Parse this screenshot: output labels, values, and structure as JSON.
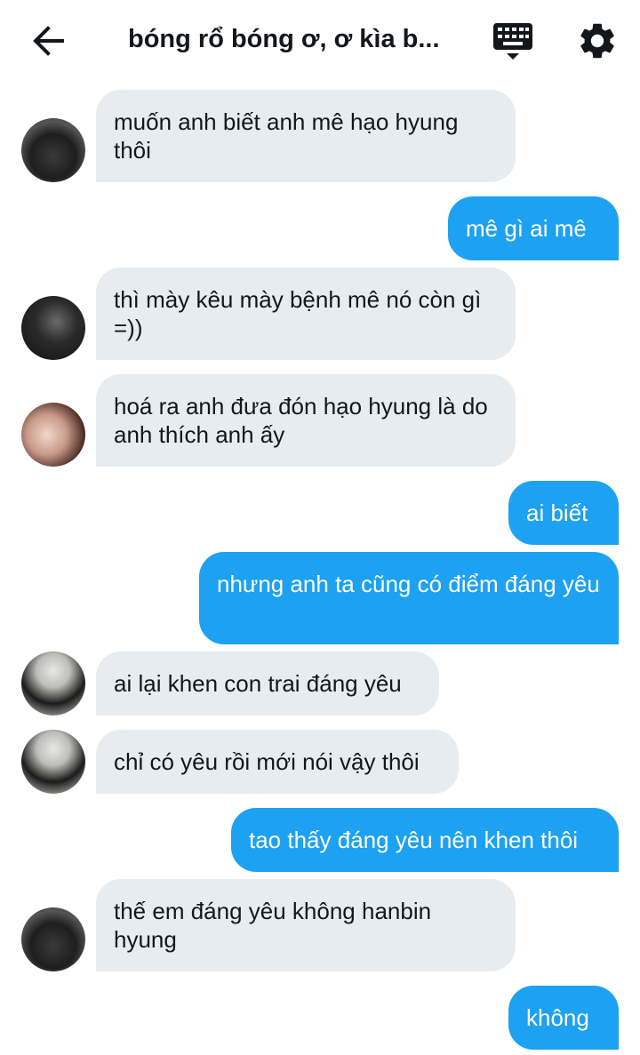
{
  "header": {
    "title": "bóng rổ bóng ơ, ơ kìa b...",
    "back_icon": "arrow-left-icon",
    "keyboard_icon": "keyboard-icon",
    "settings_icon": "gear-icon"
  },
  "colors": {
    "incoming_bubble": "#e6ecf0",
    "outgoing_bubble": "#1da1f2",
    "text_dark": "#14171a",
    "text_light": "#ffffff"
  },
  "messages": [
    {
      "direction": "incoming",
      "text": "muốn anh biết anh mê hạo hyung thôi"
    },
    {
      "direction": "outgoing",
      "text": "mê gì ai mê"
    },
    {
      "direction": "incoming",
      "text": "thì mày kêu mày bệnh mê nó còn gì =))"
    },
    {
      "direction": "incoming",
      "text": "hoá ra anh đưa đón hạo hyung là do anh thích anh ấy"
    },
    {
      "direction": "outgoing",
      "text": "ai biết"
    },
    {
      "direction": "outgoing",
      "text": "nhưng anh ta cũng có điểm đáng yêu"
    },
    {
      "direction": "incoming",
      "text": "ai lại khen con trai đáng yêu"
    },
    {
      "direction": "incoming",
      "text": "chỉ có yêu rồi mới nói vậy thôi"
    },
    {
      "direction": "outgoing",
      "text": "tao thấy đáng yêu nên khen thôi"
    },
    {
      "direction": "incoming",
      "text": "thế em đáng yêu không hanbin hyung"
    },
    {
      "direction": "outgoing",
      "text": "không"
    }
  ]
}
